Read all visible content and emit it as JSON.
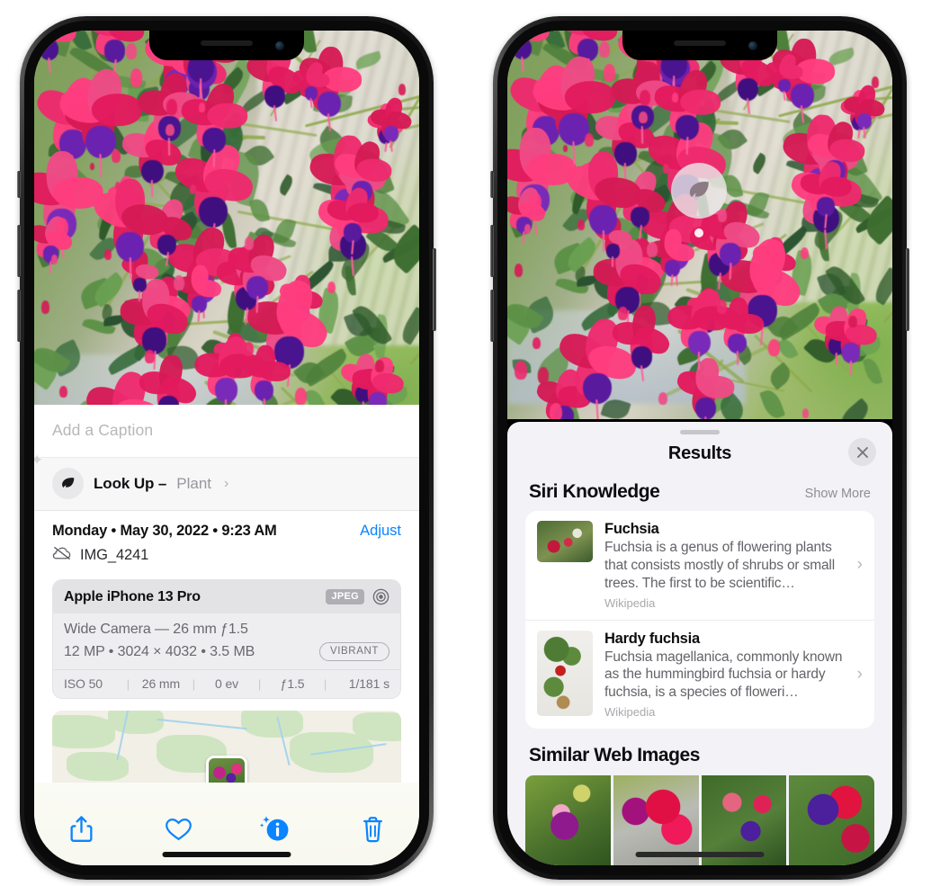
{
  "left_phone": {
    "caption_placeholder": "Add a Caption",
    "lookup": {
      "label": "Look Up –",
      "kind": "Plant",
      "chevron": "›",
      "icon": "leaf-icon"
    },
    "metadata": {
      "date": "Monday • May 30, 2022 • 9:23 AM",
      "adjust_label": "Adjust",
      "filename": "IMG_4241",
      "cloud_icon": "cloud-slash-icon"
    },
    "camera_card": {
      "device": "Apple iPhone 13 Pro",
      "format_badge": "JPEG",
      "aperture_icon": "aperture-icon",
      "lens": "Wide Camera — 26 mm ƒ1.5",
      "specs": "12 MP • 3024 × 4032 • 3.5 MB",
      "style_badge": "VIBRANT",
      "exif": [
        {
          "label": "ISO 50"
        },
        {
          "label": "26 mm"
        },
        {
          "label": "0 ev"
        },
        {
          "label": "ƒ1.5"
        },
        {
          "label": "1/181 s"
        }
      ],
      "exif_separator": "|"
    },
    "toolbar": [
      {
        "name": "share-button",
        "icon": "share-icon"
      },
      {
        "name": "favorite-button",
        "icon": "heart-icon"
      },
      {
        "name": "info-button",
        "icon": "info-sparkle-icon"
      },
      {
        "name": "delete-button",
        "icon": "trash-icon"
      }
    ],
    "accent_color": "#0a84ff"
  },
  "right_phone": {
    "photo_badge": {
      "icon": "leaf-icon",
      "name": "visual-lookup-badge"
    },
    "sheet": {
      "title": "Results",
      "close_icon": "close-icon",
      "grabber": "drag-handle"
    },
    "siri_knowledge": {
      "section_title": "Siri Knowledge",
      "action": "Show More",
      "results": [
        {
          "title": "Fuchsia",
          "description": "Fuchsia is a genus of flowering plants that consists mostly of shrubs or small trees. The first to be scientific…",
          "source": "Wikipedia",
          "chevron": "›"
        },
        {
          "title": "Hardy fuchsia",
          "description": "Fuchsia magellanica, commonly known as the hummingbird fuchsia or hardy fuchsia, is a species of floweri…",
          "source": "Wikipedia",
          "chevron": "›"
        }
      ]
    },
    "similar_web_images": {
      "section_title": "Similar Web Images",
      "thumbnails": [
        {
          "alt": "fuchsia-thumbnail-1"
        },
        {
          "alt": "fuchsia-thumbnail-2"
        },
        {
          "alt": "fuchsia-thumbnail-3"
        },
        {
          "alt": "fuchsia-thumbnail-4"
        }
      ]
    }
  }
}
